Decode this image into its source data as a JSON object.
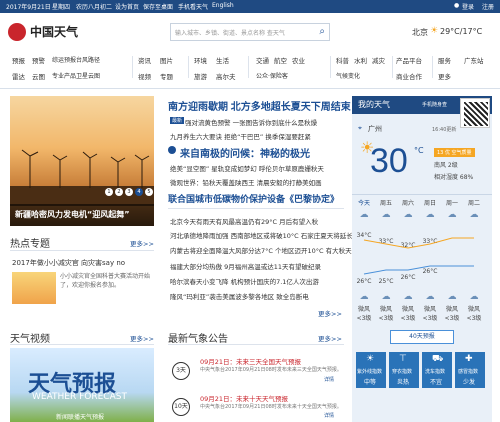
{
  "topbar": {
    "date": "2017年9月21日",
    "weekday": "星期四",
    "lunar": "农历八月初二",
    "links": [
      "设为首页",
      "保存至桌面",
      "手机看天气",
      "English"
    ],
    "login": "登录",
    "register": "注册"
  },
  "header": {
    "logo_text": "中国天气",
    "search_placeholder": "输入城市、乡镇、街道、景点名称 查天气",
    "city": "北京",
    "temp": "29°C/17°C"
  },
  "nav": {
    "group1": [
      "预报",
      "预警",
      "综运预报",
      "台风路径",
      "雷达",
      "云图",
      "专业产品",
      "卫星云图"
    ],
    "group2": [
      "资讯",
      "图片",
      "视频",
      "专题"
    ],
    "group3": [
      "环境",
      "生活",
      "旅游",
      "高尔夫"
    ],
    "group4": [
      "交通",
      "航空",
      "农业",
      "公众·保险客"
    ],
    "group5": [
      "科普",
      "水利",
      "知天",
      "减灾"
    ],
    "group6": [
      "气候变化"
    ],
    "group7": [
      "产品平台",
      "商业合作"
    ],
    "group8": [
      "服务",
      "广东站",
      "更多"
    ],
    "extra": [
      "",
      "",
      "",
      "",
      "",
      "",
      ""
    ]
  },
  "main_photo": {
    "caption": "新疆哈密风力发电机“迎风起舞”",
    "pager": [
      "1",
      "2",
      "3",
      "4",
      "5"
    ]
  },
  "headlines": {
    "top1": "南方迎雨歇期 北方多地超长夏天下周结束",
    "tag1": "最新",
    "line1": "强对流黄色预警 一张图告诉你到底什么是秋燥",
    "line2": "九月养生六大要诀 拒绝“干巴巴” 换季保湿要赶紧",
    "top2": "来自南极的问候：神秘的极光",
    "line3": "绝美“显空图” 星轨变成如梦幻 呼伦贝尔草原鹿姗秋天",
    "line4": "微观世界：铅秋天覆盖陕西王 清晨安毅的打静美如画",
    "top3": "联合国城市低碳物价保护设备《巴黎协定》",
    "list": [
      "北京今天有雨天有风最高温仍有29°C 月后有望入秋",
      "河北承德地降雨加强 西南部地区或将破10°C 石家庄夏天将延长",
      "内蒙古将迎全面降温大风部分达7°C 个地区迈开10°C 有大秋天",
      "福建大部分均热傲 9月福州高温或达11天有望破纪录",
      "哈尔滨春天小变飞降 机构预计国庆的7.1亿人次出游",
      "隆风“玛利亚”袭击美属波多黎各地区 致全岛断电"
    ],
    "more": "更多>>"
  },
  "topic": {
    "title": "热点专题",
    "more": "更多>>",
    "item_title": "2017年做小小减灾官 向灾害say no",
    "item_desc": "小小减灾官全国科普大赛活动开始了，欢迎你报名参加。"
  },
  "video": {
    "title": "天气视频",
    "more": "更多>>",
    "img_text": "天气预报",
    "img_sub": "WEATHER FORECAST",
    "caption": "新闻联播天气预报"
  },
  "bulletin": {
    "title": "最新气象公告",
    "more": "更多>>",
    "items": [
      {
        "date": "09月21日：未来三天全国天气预报",
        "desc": "中央气象台2017年09月21日08时发布未来三天全国天气预报。",
        "link": "详情",
        "badge": "3天"
      },
      {
        "date": "09月21日：未来十天天气预报",
        "desc": "中央气象台2017年09月21日08时发布未来十天全国天气预报。",
        "link": "详情",
        "badge": "10天"
      }
    ]
  },
  "myweather": {
    "title": "我的天气",
    "app_label": "手机随身查",
    "city": "广州",
    "update": "16:40更新",
    "temp": "30",
    "unit": "°C",
    "aqi": "13 优 空气质量",
    "wind": "南风 2级",
    "humidity": "相对湿度 68%",
    "days": [
      "今天",
      "周五",
      "周六",
      "周日",
      "周一",
      "周二"
    ],
    "high": [
      "34°C",
      "33°C",
      "32°C",
      "33°C",
      "",
      ""
    ],
    "low": [
      "26°C",
      "25°C",
      "26°C",
      "26°C",
      "",
      ""
    ],
    "wind_day": [
      "微风",
      "微风",
      "微风",
      "微风",
      "微风",
      "微风"
    ],
    "wind_lvl": [
      "<3级",
      "<3级",
      "<3级",
      "<3级",
      "<3级",
      "<3级"
    ],
    "forecast40": "40天预报",
    "life": [
      {
        "label": "紫外线指数",
        "value": "中等"
      },
      {
        "label": "穿衣指数",
        "value": "炎热"
      },
      {
        "label": "洗车指数",
        "value": "不宜"
      },
      {
        "label": "感冒指数",
        "value": "少发"
      }
    ]
  },
  "colors": {
    "topbar": "#1f4a82",
    "accent_blue": "#1c4f94",
    "weather_bg": "#e9f0f8",
    "aqi": "#f5a623"
  }
}
